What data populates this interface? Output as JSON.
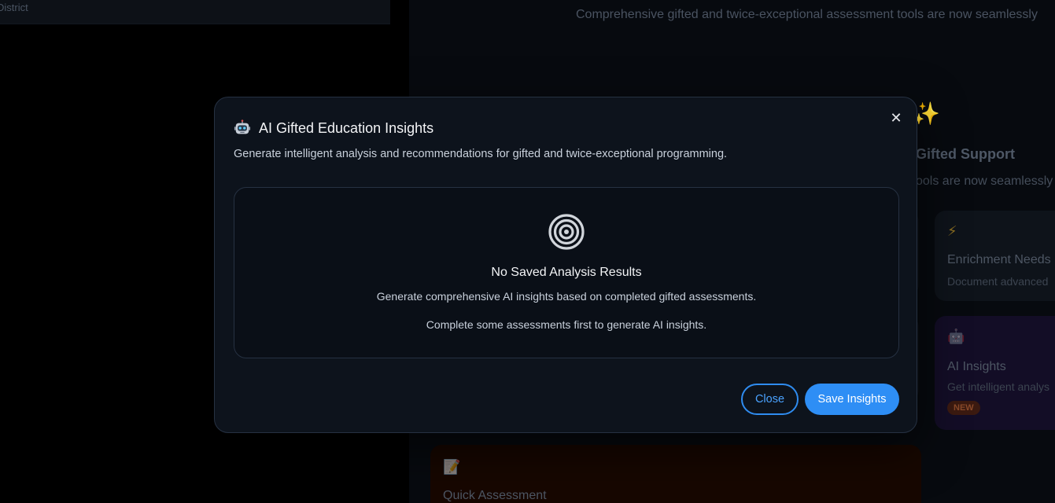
{
  "background": {
    "district_label": "District",
    "top_subtitle": "Comprehensive gifted and twice-exceptional assessment tools are now seamlessly",
    "sparkle_icon": "sparkles-icon",
    "section_heading": "Gifted Support",
    "section_subtitle": "ools are now seamlessly",
    "cards": [
      {
        "icon": "⚡",
        "title": "Enrichment Needs",
        "description": "Document advanced"
      },
      {
        "icon": "🤖",
        "title": "AI Insights",
        "description": "Get intelligent analys",
        "badge": "NEW"
      },
      {
        "icon": "📝",
        "title": "Quick Assessment"
      }
    ]
  },
  "modal": {
    "icon": "robot-icon",
    "title": "AI Gifted Education Insights",
    "description": "Generate intelligent analysis and recommendations for gifted and twice-exceptional programming.",
    "close_symbol": "✕",
    "empty_state": {
      "icon": "target-icon",
      "title": "No Saved Analysis Results",
      "line1": "Generate comprehensive AI insights based on completed gifted assessments.",
      "line2": "Complete some assessments first to generate AI insights."
    },
    "buttons": {
      "close_label": "Close",
      "save_label": "Save Insights"
    }
  },
  "colors": {
    "accent": "#2e8ef5",
    "modal_bg": "#0d131c",
    "border": "#263142"
  }
}
